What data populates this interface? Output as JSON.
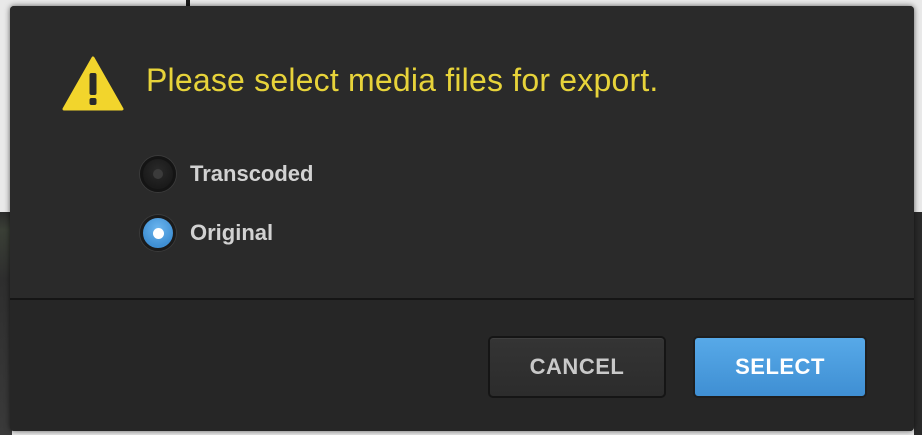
{
  "dialog": {
    "message": "Please select media files for export.",
    "warning_icon": "warning-triangle-icon",
    "options": [
      {
        "label": "Transcoded",
        "selected": false
      },
      {
        "label": "Original",
        "selected": true
      }
    ],
    "buttons": {
      "cancel_label": "CANCEL",
      "select_label": "SELECT"
    }
  },
  "colors": {
    "message": "#e7d33a",
    "warning_icon": "#f2d52c",
    "accent": "#4a9ee0",
    "dialog_bg": "#2a2a2a"
  }
}
